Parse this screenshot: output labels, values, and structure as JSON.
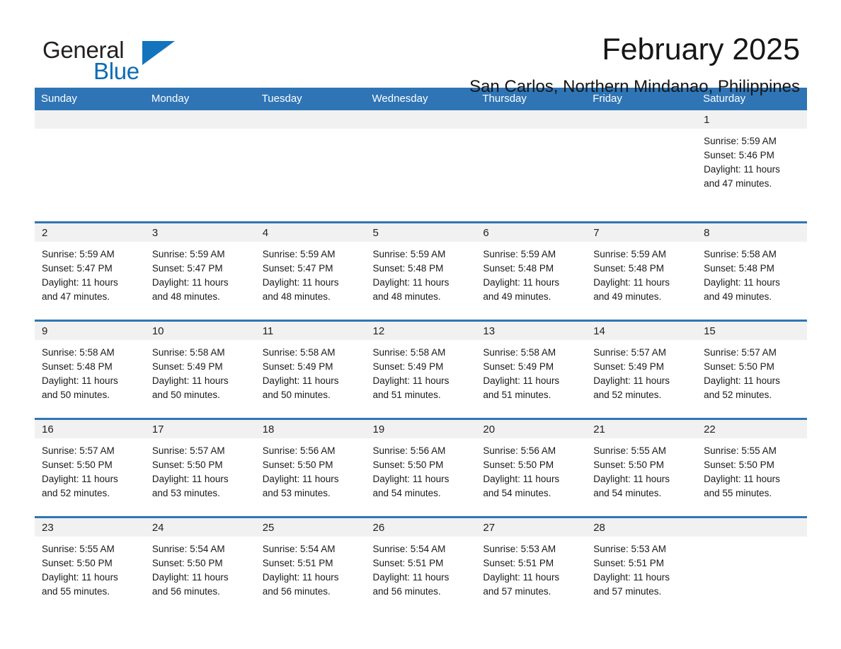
{
  "brand": {
    "name_part1": "General",
    "name_part2": "Blue",
    "triangle_color": "#1274bc",
    "text_color": "#231f20"
  },
  "header": {
    "title": "February 2025",
    "subtitle": "San Carlos, Northern Mindanao, Philippines"
  },
  "theme": {
    "header_blue": "#2f75b5",
    "band_grey": "#f1f1f1",
    "text": "#1a1a1a"
  },
  "weekdays": [
    "Sunday",
    "Monday",
    "Tuesday",
    "Wednesday",
    "Thursday",
    "Friday",
    "Saturday"
  ],
  "weeks": [
    {
      "days": [
        {
          "num": "",
          "sunrise": "",
          "sunset": "",
          "daylight1": "",
          "daylight2": ""
        },
        {
          "num": "",
          "sunrise": "",
          "sunset": "",
          "daylight1": "",
          "daylight2": ""
        },
        {
          "num": "",
          "sunrise": "",
          "sunset": "",
          "daylight1": "",
          "daylight2": ""
        },
        {
          "num": "",
          "sunrise": "",
          "sunset": "",
          "daylight1": "",
          "daylight2": ""
        },
        {
          "num": "",
          "sunrise": "",
          "sunset": "",
          "daylight1": "",
          "daylight2": ""
        },
        {
          "num": "",
          "sunrise": "",
          "sunset": "",
          "daylight1": "",
          "daylight2": ""
        },
        {
          "num": "1",
          "sunrise": "Sunrise: 5:59 AM",
          "sunset": "Sunset: 5:46 PM",
          "daylight1": "Daylight: 11 hours",
          "daylight2": "and 47 minutes."
        }
      ]
    },
    {
      "days": [
        {
          "num": "2",
          "sunrise": "Sunrise: 5:59 AM",
          "sunset": "Sunset: 5:47 PM",
          "daylight1": "Daylight: 11 hours",
          "daylight2": "and 47 minutes."
        },
        {
          "num": "3",
          "sunrise": "Sunrise: 5:59 AM",
          "sunset": "Sunset: 5:47 PM",
          "daylight1": "Daylight: 11 hours",
          "daylight2": "and 48 minutes."
        },
        {
          "num": "4",
          "sunrise": "Sunrise: 5:59 AM",
          "sunset": "Sunset: 5:47 PM",
          "daylight1": "Daylight: 11 hours",
          "daylight2": "and 48 minutes."
        },
        {
          "num": "5",
          "sunrise": "Sunrise: 5:59 AM",
          "sunset": "Sunset: 5:48 PM",
          "daylight1": "Daylight: 11 hours",
          "daylight2": "and 48 minutes."
        },
        {
          "num": "6",
          "sunrise": "Sunrise: 5:59 AM",
          "sunset": "Sunset: 5:48 PM",
          "daylight1": "Daylight: 11 hours",
          "daylight2": "and 49 minutes."
        },
        {
          "num": "7",
          "sunrise": "Sunrise: 5:59 AM",
          "sunset": "Sunset: 5:48 PM",
          "daylight1": "Daylight: 11 hours",
          "daylight2": "and 49 minutes."
        },
        {
          "num": "8",
          "sunrise": "Sunrise: 5:58 AM",
          "sunset": "Sunset: 5:48 PM",
          "daylight1": "Daylight: 11 hours",
          "daylight2": "and 49 minutes."
        }
      ]
    },
    {
      "days": [
        {
          "num": "9",
          "sunrise": "Sunrise: 5:58 AM",
          "sunset": "Sunset: 5:48 PM",
          "daylight1": "Daylight: 11 hours",
          "daylight2": "and 50 minutes."
        },
        {
          "num": "10",
          "sunrise": "Sunrise: 5:58 AM",
          "sunset": "Sunset: 5:49 PM",
          "daylight1": "Daylight: 11 hours",
          "daylight2": "and 50 minutes."
        },
        {
          "num": "11",
          "sunrise": "Sunrise: 5:58 AM",
          "sunset": "Sunset: 5:49 PM",
          "daylight1": "Daylight: 11 hours",
          "daylight2": "and 50 minutes."
        },
        {
          "num": "12",
          "sunrise": "Sunrise: 5:58 AM",
          "sunset": "Sunset: 5:49 PM",
          "daylight1": "Daylight: 11 hours",
          "daylight2": "and 51 minutes."
        },
        {
          "num": "13",
          "sunrise": "Sunrise: 5:58 AM",
          "sunset": "Sunset: 5:49 PM",
          "daylight1": "Daylight: 11 hours",
          "daylight2": "and 51 minutes."
        },
        {
          "num": "14",
          "sunrise": "Sunrise: 5:57 AM",
          "sunset": "Sunset: 5:49 PM",
          "daylight1": "Daylight: 11 hours",
          "daylight2": "and 52 minutes."
        },
        {
          "num": "15",
          "sunrise": "Sunrise: 5:57 AM",
          "sunset": "Sunset: 5:50 PM",
          "daylight1": "Daylight: 11 hours",
          "daylight2": "and 52 minutes."
        }
      ]
    },
    {
      "days": [
        {
          "num": "16",
          "sunrise": "Sunrise: 5:57 AM",
          "sunset": "Sunset: 5:50 PM",
          "daylight1": "Daylight: 11 hours",
          "daylight2": "and 52 minutes."
        },
        {
          "num": "17",
          "sunrise": "Sunrise: 5:57 AM",
          "sunset": "Sunset: 5:50 PM",
          "daylight1": "Daylight: 11 hours",
          "daylight2": "and 53 minutes."
        },
        {
          "num": "18",
          "sunrise": "Sunrise: 5:56 AM",
          "sunset": "Sunset: 5:50 PM",
          "daylight1": "Daylight: 11 hours",
          "daylight2": "and 53 minutes."
        },
        {
          "num": "19",
          "sunrise": "Sunrise: 5:56 AM",
          "sunset": "Sunset: 5:50 PM",
          "daylight1": "Daylight: 11 hours",
          "daylight2": "and 54 minutes."
        },
        {
          "num": "20",
          "sunrise": "Sunrise: 5:56 AM",
          "sunset": "Sunset: 5:50 PM",
          "daylight1": "Daylight: 11 hours",
          "daylight2": "and 54 minutes."
        },
        {
          "num": "21",
          "sunrise": "Sunrise: 5:55 AM",
          "sunset": "Sunset: 5:50 PM",
          "daylight1": "Daylight: 11 hours",
          "daylight2": "and 54 minutes."
        },
        {
          "num": "22",
          "sunrise": "Sunrise: 5:55 AM",
          "sunset": "Sunset: 5:50 PM",
          "daylight1": "Daylight: 11 hours",
          "daylight2": "and 55 minutes."
        }
      ]
    },
    {
      "days": [
        {
          "num": "23",
          "sunrise": "Sunrise: 5:55 AM",
          "sunset": "Sunset: 5:50 PM",
          "daylight1": "Daylight: 11 hours",
          "daylight2": "and 55 minutes."
        },
        {
          "num": "24",
          "sunrise": "Sunrise: 5:54 AM",
          "sunset": "Sunset: 5:50 PM",
          "daylight1": "Daylight: 11 hours",
          "daylight2": "and 56 minutes."
        },
        {
          "num": "25",
          "sunrise": "Sunrise: 5:54 AM",
          "sunset": "Sunset: 5:51 PM",
          "daylight1": "Daylight: 11 hours",
          "daylight2": "and 56 minutes."
        },
        {
          "num": "26",
          "sunrise": "Sunrise: 5:54 AM",
          "sunset": "Sunset: 5:51 PM",
          "daylight1": "Daylight: 11 hours",
          "daylight2": "and 56 minutes."
        },
        {
          "num": "27",
          "sunrise": "Sunrise: 5:53 AM",
          "sunset": "Sunset: 5:51 PM",
          "daylight1": "Daylight: 11 hours",
          "daylight2": "and 57 minutes."
        },
        {
          "num": "28",
          "sunrise": "Sunrise: 5:53 AM",
          "sunset": "Sunset: 5:51 PM",
          "daylight1": "Daylight: 11 hours",
          "daylight2": "and 57 minutes."
        },
        {
          "num": "",
          "sunrise": "",
          "sunset": "",
          "daylight1": "",
          "daylight2": ""
        }
      ]
    }
  ]
}
